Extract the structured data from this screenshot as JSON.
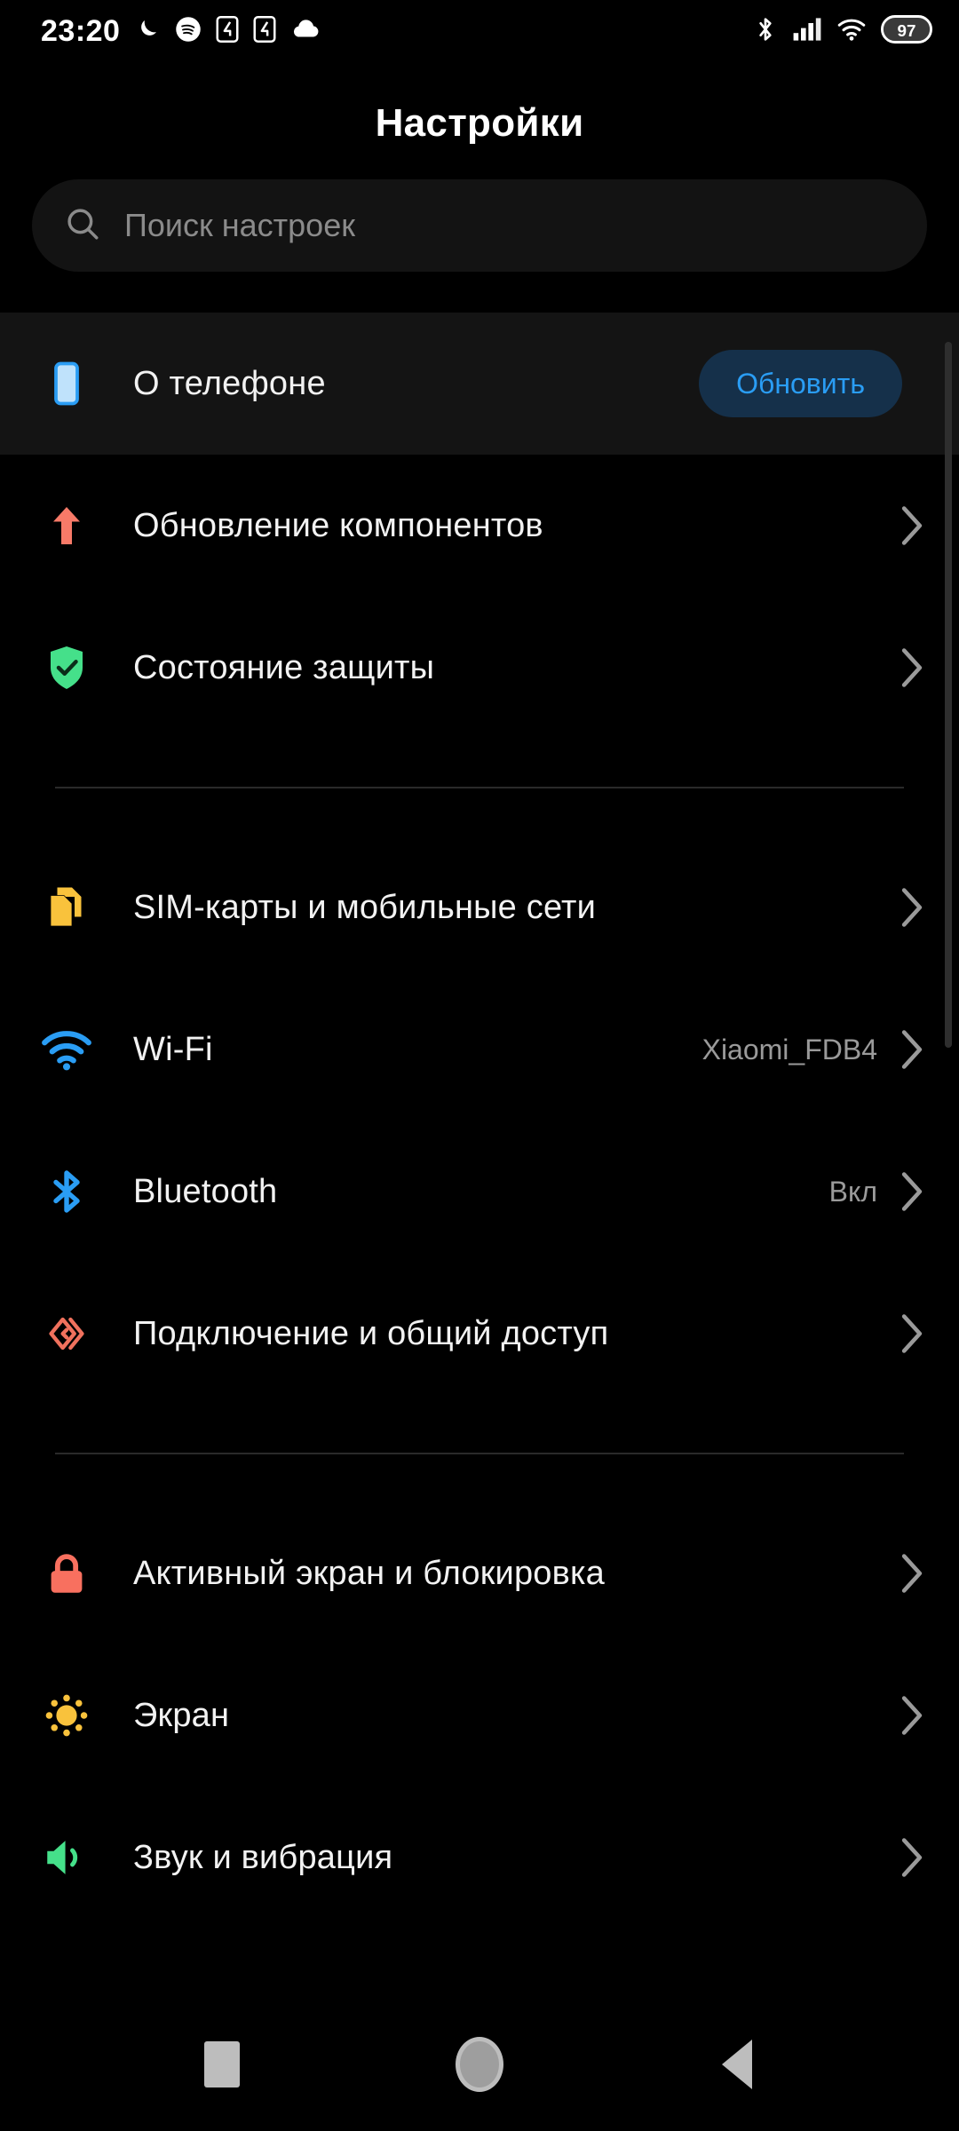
{
  "statusbar": {
    "time": "23:20",
    "left_icons": [
      "moon-icon",
      "spotify-icon",
      "app-notification-icon",
      "app-notification-icon",
      "cloud-icon"
    ],
    "right_icons": [
      "bluetooth-icon",
      "cellular-signal-icon",
      "wifi-icon"
    ],
    "battery_level": "97"
  },
  "header": {
    "title": "Настройки"
  },
  "search": {
    "placeholder": "Поиск настроек",
    "value": "",
    "icon": "search-icon"
  },
  "groups": [
    {
      "id": "group-device",
      "items": [
        {
          "id": "about-phone",
          "label": "О телефоне",
          "value": "",
          "icon": "phone-icon",
          "icon_color": "#a8d8f8",
          "highlighted": true,
          "action_label": "Обновить",
          "chevron": false
        },
        {
          "id": "component-update",
          "label": "Обновление компонентов",
          "value": "",
          "icon": "arrow-up-icon",
          "icon_color": "#f87a68",
          "highlighted": false,
          "action_label": "",
          "chevron": true
        },
        {
          "id": "security-status",
          "label": "Состояние защиты",
          "value": "",
          "icon": "shield-check-icon",
          "icon_color": "#45e08a",
          "highlighted": false,
          "action_label": "",
          "chevron": true
        }
      ]
    },
    {
      "id": "group-connectivity",
      "items": [
        {
          "id": "sim-cards",
          "label": "SIM-карты и мобильные сети",
          "value": "",
          "icon": "sim-card-icon",
          "icon_color": "#f9c23c",
          "highlighted": false,
          "action_label": "",
          "chevron": true
        },
        {
          "id": "wifi",
          "label": "Wi-Fi",
          "value": "Xiaomi_FDB4",
          "icon": "wifi-icon",
          "icon_color": "#2a9df4",
          "highlighted": false,
          "action_label": "",
          "chevron": true
        },
        {
          "id": "bluetooth",
          "label": "Bluetooth",
          "value": "Вкл",
          "icon": "bluetooth-icon",
          "icon_color": "#2a9df4",
          "highlighted": false,
          "action_label": "",
          "chevron": true
        },
        {
          "id": "connection-sharing",
          "label": "Подключение и общий доступ",
          "value": "",
          "icon": "share-connection-icon",
          "icon_color": "#f0715d",
          "highlighted": false,
          "action_label": "",
          "chevron": true
        }
      ]
    },
    {
      "id": "group-display",
      "items": [
        {
          "id": "lock-screen",
          "label": "Активный экран и блокировка",
          "value": "",
          "icon": "lock-icon",
          "icon_color": "#f8705f",
          "highlighted": false,
          "action_label": "",
          "chevron": true
        },
        {
          "id": "display",
          "label": "Экран",
          "value": "",
          "icon": "sun-icon",
          "icon_color": "#f9c23c",
          "highlighted": false,
          "action_label": "",
          "chevron": true
        },
        {
          "id": "sound-vibration",
          "label": "Звук и вибрация",
          "value": "",
          "icon": "speaker-icon",
          "icon_color": "#45e08a",
          "highlighted": false,
          "action_label": "",
          "chevron": true
        }
      ]
    }
  ],
  "navbar": {
    "recents": "recents-square-icon",
    "home": "home-circle-icon",
    "back": "back-triangle-icon"
  }
}
